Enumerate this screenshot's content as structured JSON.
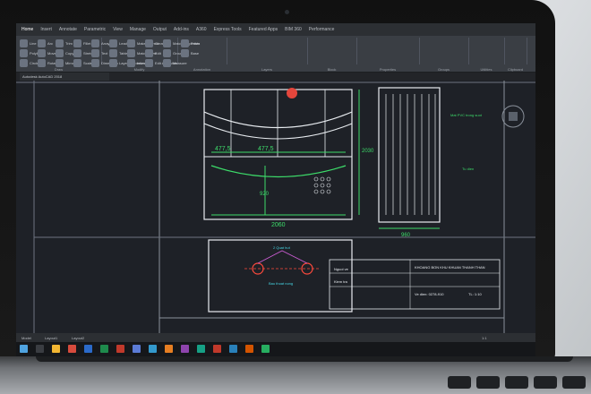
{
  "app": {
    "title": "Autodesk AutoCAD 2018",
    "tabs": [
      "Home",
      "Insert",
      "Annotate",
      "Parametric",
      "View",
      "Manage",
      "Output",
      "Add-ins",
      "A360",
      "Express Tools",
      "Featured Apps",
      "BIM 360",
      "Performance"
    ],
    "active_tab": "Home"
  },
  "ribbon": {
    "groups": [
      "Draw",
      "Modify",
      "Annotation",
      "Layers",
      "Block",
      "Properties",
      "Groups",
      "Utilities",
      "Clipboard",
      "View"
    ],
    "buttons": [
      "Line",
      "Polyline",
      "Circle",
      "Arc",
      "Move",
      "Rotate",
      "Trim",
      "Copy",
      "Mirror",
      "Fillet",
      "Stretch",
      "Scale",
      "Array",
      "Text",
      "Dimension",
      "Leader",
      "Table",
      "Layer Properties",
      "Make Current",
      "Match Layer",
      "Insert",
      "Create",
      "Edit",
      "Edit Attributes",
      "Match Properties",
      "Group",
      "Measure",
      "Paste",
      "Base"
    ]
  },
  "drawing": {
    "dims": [
      "477,5",
      "477,5",
      "2060",
      "920",
      "960",
      "2030"
    ],
    "labels": [
      "2 Quat hut",
      "Bau thoat nong",
      "Cac loai kinh",
      "Tu dien",
      "Mat PVC trong suot"
    ],
    "title_block": [
      "KHOANG BON KHU KHUAN THANH THAN",
      "Nguoi ve",
      "Kiem tra",
      "Ve dien: 0278-910",
      "TL: 1:10",
      "Bd: 0"
    ]
  },
  "status": {
    "model": "Model",
    "layouts": [
      "Layout1",
      "Layout2"
    ],
    "coords": "1:1"
  },
  "colors": {
    "cad_bg": "#1e2127",
    "line_white": "#e8ecf0",
    "dim_green": "#3ddc6a",
    "dim_cyan": "#46d7e6",
    "dim_red": "#ff4a3d",
    "magenta": "#cf5ed6"
  }
}
